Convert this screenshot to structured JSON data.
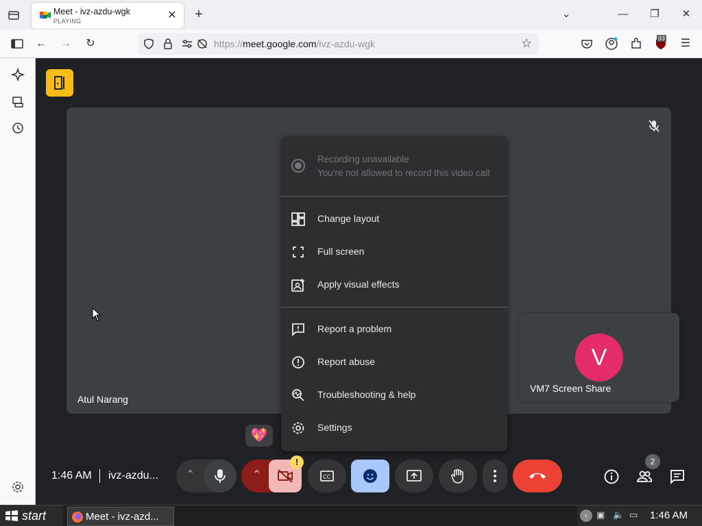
{
  "browser": {
    "tab": {
      "title": "Meet - ivz-azdu-wgk",
      "subtitle": "PLAYING"
    },
    "url": {
      "prefix": "https://",
      "host": "meet.google.com",
      "path": "/ivz-azdu-wgk"
    },
    "extension_badge": "93"
  },
  "meet": {
    "presenter_name": "Atul Narang",
    "tile": {
      "avatar_letter": "V",
      "label": "VM7 Screen Share"
    },
    "menu": {
      "recording_title": "Recording unavailable",
      "recording_subtitle": "You're not allowed to record this video call",
      "items": [
        {
          "label": "Change layout",
          "icon": "layout-icon"
        },
        {
          "label": "Full screen",
          "icon": "fullscreen-icon"
        },
        {
          "label": "Apply visual effects",
          "icon": "visual-effects-icon"
        },
        {
          "label": "Report a problem",
          "icon": "report-problem-icon"
        },
        {
          "label": "Report abuse",
          "icon": "report-abuse-icon"
        },
        {
          "label": "Troubleshooting & help",
          "icon": "troubleshooting-icon"
        },
        {
          "label": "Settings",
          "icon": "settings-icon"
        }
      ]
    },
    "bottom_bar": {
      "time": "1:46 AM",
      "meeting_code": "ivz-azdu...",
      "participants_count": "2",
      "camera_warning": "!"
    },
    "colors": {
      "end_call": "#ea4335",
      "reactions_active": "#a8c7fa",
      "camera_off": "#f2b8b5",
      "avatar": "#e52c6b"
    }
  },
  "taskbar": {
    "start_label": "start",
    "app_label": "Meet - ivz-azd...",
    "clock": "1:46 AM"
  }
}
